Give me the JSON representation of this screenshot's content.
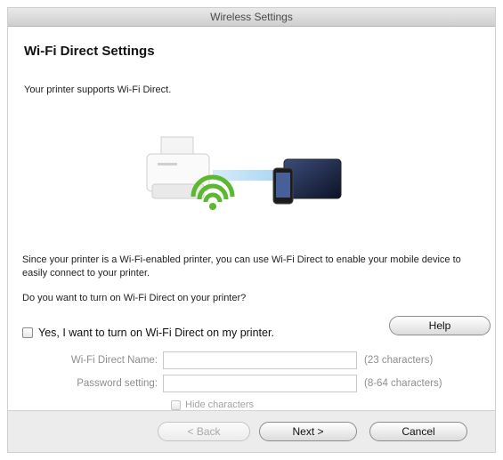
{
  "window": {
    "title": "Wireless Settings"
  },
  "content": {
    "heading": "Wi-Fi Direct Settings",
    "support_text": "Your printer supports Wi-Fi Direct.",
    "description": "Since your printer is a Wi-Fi-enabled printer, you can use Wi-Fi Direct to enable your mobile device to easily connect to your printer.",
    "question": "Do you want to turn on Wi-Fi Direct on your printer?",
    "enable_checkbox": {
      "label": "Yes, I want to turn on Wi-Fi Direct on my printer.",
      "checked": false
    },
    "help_label": "Help",
    "fields": {
      "name": {
        "label": "Wi-Fi Direct Name:",
        "value": "",
        "hint": "(23 characters)"
      },
      "password": {
        "label": "Password setting:",
        "value": "",
        "hint": "(8-64 characters)"
      }
    },
    "hide_characters": {
      "label": "Hide characters",
      "checked": false
    }
  },
  "footer": {
    "back_label": "< Back",
    "next_label": "Next >",
    "cancel_label": "Cancel"
  },
  "icons": {
    "printer": "printer-icon",
    "wifi": "wifi-icon",
    "devices": "mobile-devices-icon"
  },
  "colors": {
    "wifi_green": "#5cb82e",
    "beam_blue": "#9fd0f0"
  }
}
